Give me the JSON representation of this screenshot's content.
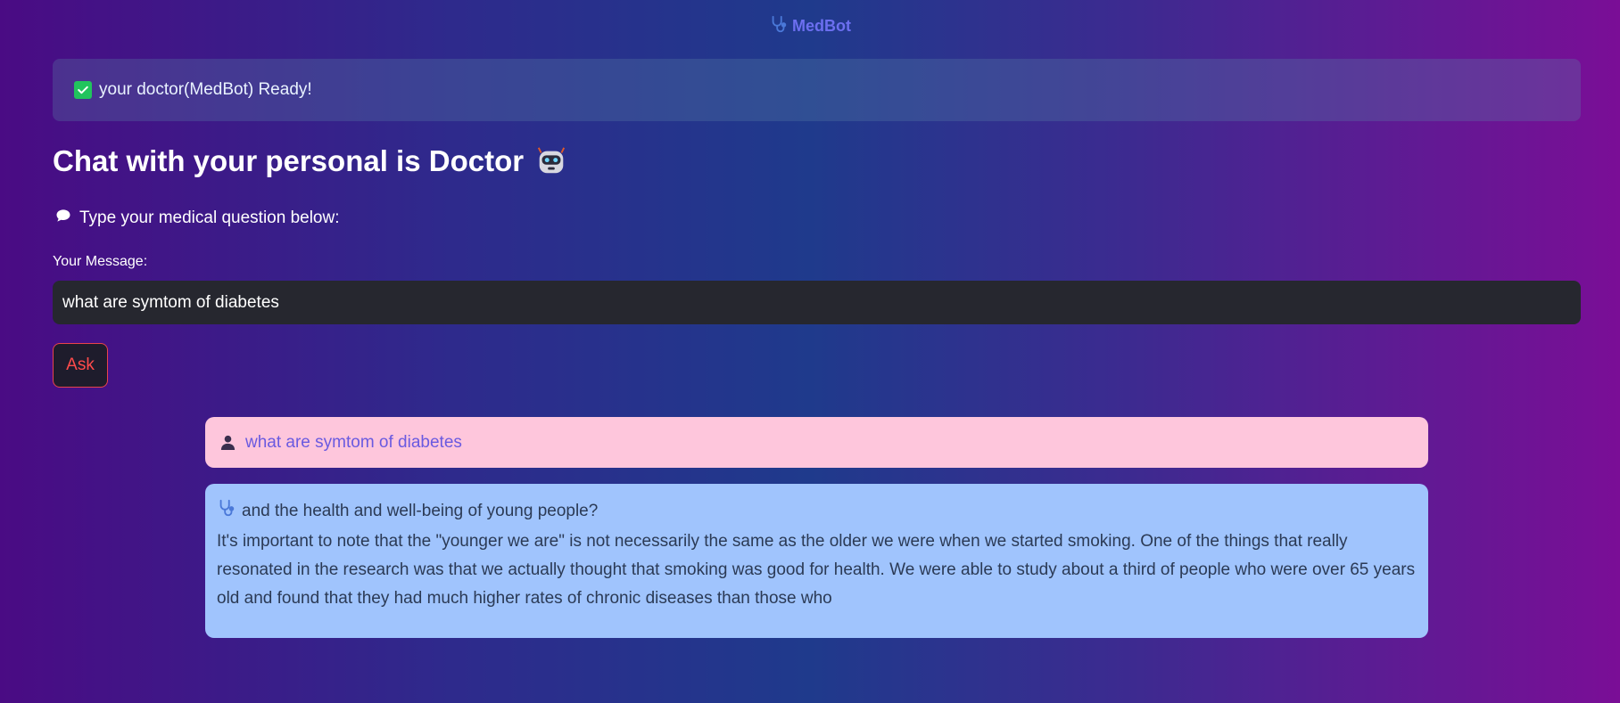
{
  "header": {
    "app_name": "MedBot",
    "icon": "stethoscope-icon"
  },
  "status": {
    "icon": "check-icon",
    "text": "your doctor(MedBot) Ready!"
  },
  "main": {
    "title": "Chat with your personal is Doctor",
    "title_icon": "robot-icon",
    "subtitle": "Type your medical question below:",
    "subtitle_icon": "speech-bubble-icon",
    "input_label": "Your Message:",
    "input_value": "what are symtom of diabetes",
    "ask_label": "Ask"
  },
  "chat": {
    "messages": [
      {
        "role": "user",
        "icon": "user-icon",
        "text": "what are symtom of diabetes"
      },
      {
        "role": "bot",
        "icon": "stethoscope-icon",
        "first_line": "and the health and well-being of young people?",
        "body": "It's important to note that the \"younger we are\" is not necessarily the same as the older we were when we started smoking. One of the things that really resonated in the research was that we actually thought that smoking was good for health. We were able to study about a third of people who were over 65 years old and found that they had much higher rates of chronic diseases than those who"
      }
    ]
  },
  "colors": {
    "accent_red": "#ff4b4b",
    "user_bubble": "#fec6dc",
    "bot_bubble": "#a0c4fd",
    "success_green": "#21c45d"
  }
}
